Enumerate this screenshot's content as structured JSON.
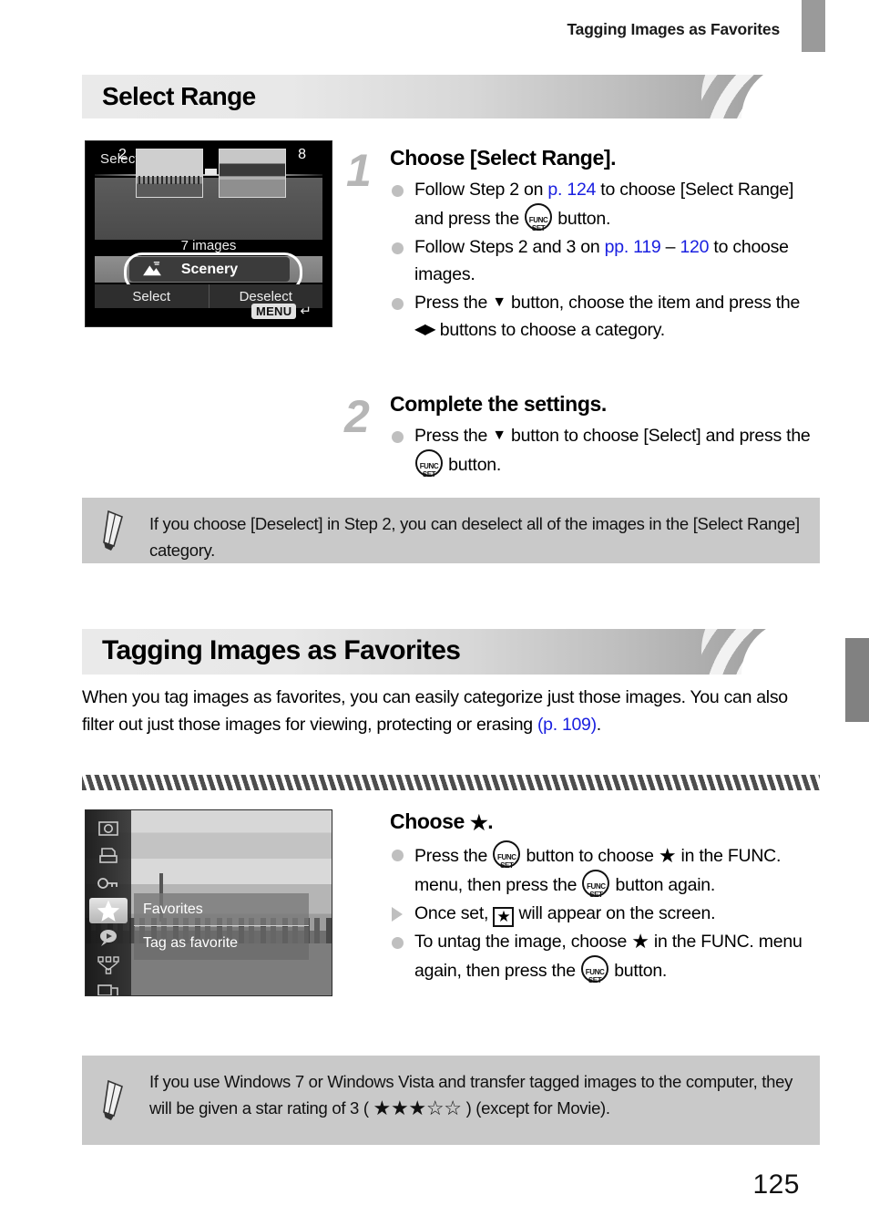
{
  "header": {
    "running_title": "Tagging Images as Favorites"
  },
  "page_number": "125",
  "sections": [
    {
      "id": "select-range",
      "bar_title": "Select Range",
      "screen": {
        "title": "Select Range",
        "left_number": "2",
        "right_number": "8",
        "count_label": "7 images",
        "category_label": "Scenery",
        "category_icon": "scenery-icon",
        "button_select": "Select",
        "button_deselect": "Deselect",
        "menu_label": "MENU",
        "menu_arrow": "↵"
      },
      "steps": [
        {
          "number": "1",
          "title": "Choose [Select Range].",
          "bullets": [
            {
              "marker": "dot",
              "parts": [
                {
                  "t": "text",
                  "v": "Follow Step 2 on "
                },
                {
                  "t": "link",
                  "v": "p. 124"
                },
                {
                  "t": "text",
                  "v": " to choose [Select Range] and press the "
                },
                {
                  "t": "icon",
                  "v": "func-set-icon"
                },
                {
                  "t": "text",
                  "v": " button."
                }
              ]
            },
            {
              "marker": "dot",
              "parts": [
                {
                  "t": "text",
                  "v": "Follow Steps 2 and 3 on "
                },
                {
                  "t": "link",
                  "v": "pp. 119"
                },
                {
                  "t": "text",
                  "v": " – "
                },
                {
                  "t": "link",
                  "v": "120"
                },
                {
                  "t": "text",
                  "v": " to choose images."
                }
              ]
            },
            {
              "marker": "dot",
              "parts": [
                {
                  "t": "text",
                  "v": "Press the "
                },
                {
                  "t": "icon",
                  "v": "down-arrow-icon"
                },
                {
                  "t": "text",
                  "v": " button, choose the item and press the "
                },
                {
                  "t": "icon",
                  "v": "left-right-arrow-icon"
                },
                {
                  "t": "text",
                  "v": " buttons to choose a category."
                }
              ]
            }
          ]
        },
        {
          "number": "2",
          "title": "Complete the settings.",
          "bullets": [
            {
              "marker": "dot",
              "parts": [
                {
                  "t": "text",
                  "v": "Press the "
                },
                {
                  "t": "icon",
                  "v": "down-arrow-icon"
                },
                {
                  "t": "text",
                  "v": " button to choose [Select] and press the "
                },
                {
                  "t": "icon",
                  "v": "func-set-icon"
                },
                {
                  "t": "text",
                  "v": " button."
                }
              ]
            }
          ]
        }
      ],
      "note": {
        "icon": "pencil-icon",
        "text": "If you choose [Deselect] in Step 2, you can deselect all of the images in the [Select Range] category."
      }
    },
    {
      "id": "tagging-images-as-favorites",
      "bar_title": "Tagging Images as Favorites",
      "intro_parts": [
        {
          "t": "text",
          "v": "When you tag images as favorites, you can easily categorize just those images. You can also filter out just those images for viewing, protecting or erasing "
        },
        {
          "t": "link",
          "v": "(p. 109)"
        },
        {
          "t": "text",
          "v": "."
        }
      ],
      "screen": {
        "sidebar_icons": [
          "rotate-icon",
          "print-icon",
          "protect-key-icon",
          "favorites-star-icon",
          "sound-memo-icon",
          "category-icon",
          "transition-icon"
        ],
        "selected_icon": "favorites-star-icon",
        "menu_title": "Favorites",
        "menu_item": "Tag as favorite"
      },
      "steps": [
        {
          "number": "",
          "title_parts": [
            {
              "t": "text",
              "v": "Choose "
            },
            {
              "t": "icon",
              "v": "star-filled-icon"
            },
            {
              "t": "text",
              "v": "."
            }
          ],
          "bullets": [
            {
              "marker": "dot",
              "parts": [
                {
                  "t": "text",
                  "v": "Press the "
                },
                {
                  "t": "icon",
                  "v": "func-set-icon"
                },
                {
                  "t": "text",
                  "v": " button to choose "
                },
                {
                  "t": "icon",
                  "v": "star-filled-icon"
                },
                {
                  "t": "text",
                  "v": " in the FUNC. menu, then press the "
                },
                {
                  "t": "icon",
                  "v": "func-set-icon"
                },
                {
                  "t": "text",
                  "v": " button again."
                }
              ]
            },
            {
              "marker": "triangle",
              "parts": [
                {
                  "t": "text",
                  "v": "Once set, "
                },
                {
                  "t": "icon",
                  "v": "star-boxed-icon"
                },
                {
                  "t": "text",
                  "v": " will appear on the screen."
                }
              ]
            },
            {
              "marker": "dot",
              "parts": [
                {
                  "t": "text",
                  "v": "To untag the image, choose "
                },
                {
                  "t": "icon",
                  "v": "star-filled-icon"
                },
                {
                  "t": "text",
                  "v": " in the FUNC. menu again, then press the "
                },
                {
                  "t": "icon",
                  "v": "func-set-icon"
                },
                {
                  "t": "text",
                  "v": " button."
                }
              ]
            }
          ]
        }
      ],
      "note": {
        "icon": "pencil-icon",
        "text_before": "If you use Windows 7 or Windows Vista and transfer tagged images to the computer, they will be given a star rating of 3 ( ",
        "stars_filled": 3,
        "stars_empty": 2,
        "text_after": " ) (except for Movie)."
      }
    }
  ],
  "colors": {
    "link": "#1a20e0",
    "note_bg": "#c9c9c9",
    "bullet_dot": "#bfbfbf",
    "step_number": "#b6b6b6",
    "edge_tab": "#9a9a9a"
  }
}
